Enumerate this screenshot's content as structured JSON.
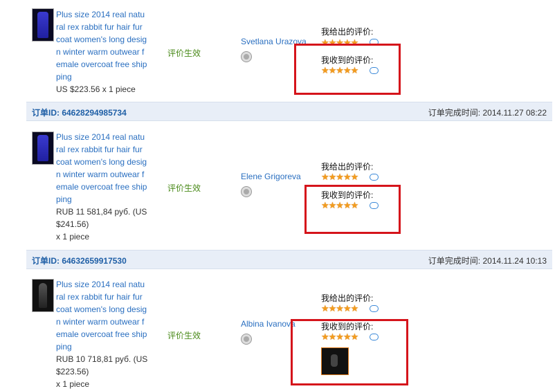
{
  "orders": [
    {
      "product_title": "Plus size 2014 real natural rex rabbit fur hair fur coat women's long design winter warm outwear female overcoat free shipping",
      "price": "US $223.56 x 1 piece",
      "status": "评价生效",
      "buyer": "Svetlana Urazova",
      "given_label": "我给出的评价:",
      "received_label": "我收到的评价:",
      "given_stars": "★★★★★",
      "received_stars": "★★★★★"
    },
    {
      "order_id": "订单ID: 64628294985734",
      "completed_time": "订单完成时间: 2014.11.27 08:22",
      "product_title": "Plus size 2014 real natural rex rabbit fur hair fur coat women's long design winter warm outwear female overcoat free shipping",
      "price": "RUB 11 581,84 руб. (US $241.56)",
      "quantity": "x 1 piece",
      "status": "评价生效",
      "buyer": "Elene Grigoreva",
      "given_label": "我给出的评价:",
      "received_label": "我收到的评价:",
      "given_stars": "★★★★★",
      "received_stars": "★★★★★"
    },
    {
      "order_id": "订单ID: 64632659917530",
      "completed_time": "订单完成时间: 2014.11.24 10:13",
      "product_title": "Plus size 2014 real natural rex rabbit fur hair fur coat women's long design winter warm outwear female overcoat free shipping",
      "price": "RUB 10 718,81 руб. (US $223.56)",
      "quantity": "x 1 piece",
      "status": "评价生效",
      "buyer": "Albina Ivanova",
      "given_label": "我给出的评价:",
      "received_label": "我收到的评价:",
      "given_stars": "★★★★★",
      "received_stars": "★★★★★"
    }
  ],
  "icons": {
    "thumb_1": "coat-thumbnail-icon",
    "face": "buyer-avatar-icon",
    "bubble": "comment-bubble-icon"
  },
  "colors": {
    "link": "#2a6fc0",
    "status": "#4a8a1a",
    "highlight_box": "#d5141b",
    "star": "#f29c1f",
    "header_bg": "#e8eef7"
  }
}
